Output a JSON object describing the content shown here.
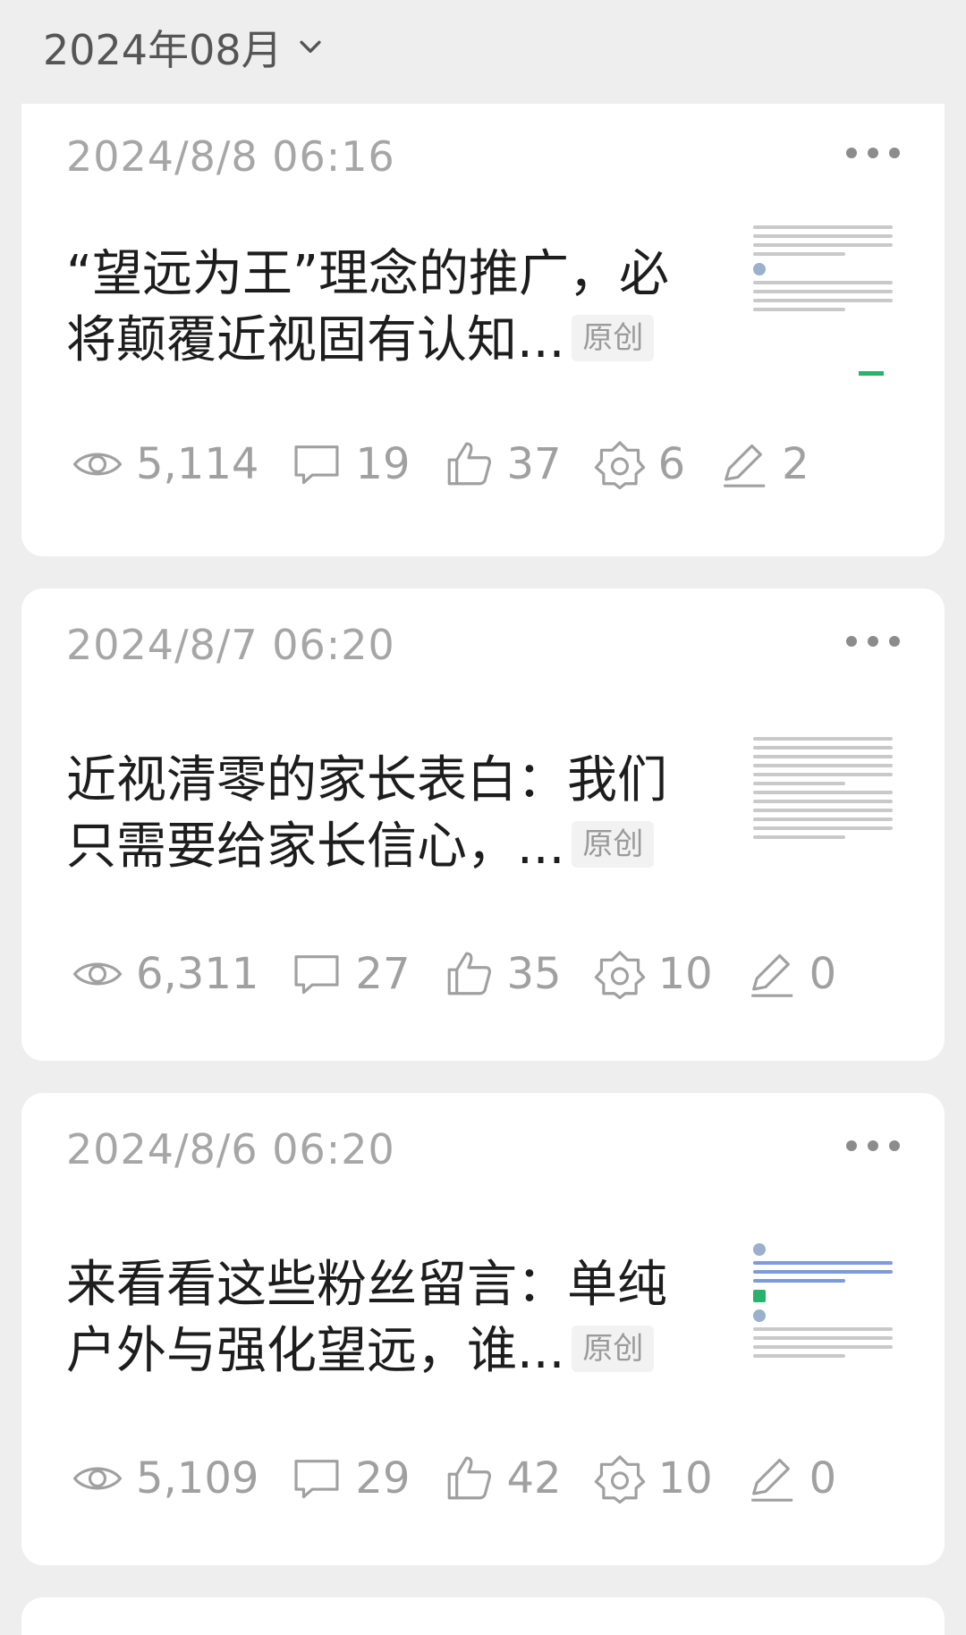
{
  "header": {
    "month_label": "2024年08月",
    "dropdown_icon": "chevron-down-icon"
  },
  "articles": [
    {
      "date": "2024/8/8 06:16",
      "title": "“望远为王”理念的推广，必将颠覆近视固有认知...",
      "tag": "原创",
      "stats": {
        "views": "5,114",
        "comments": "19",
        "likes": "37",
        "shares": "6",
        "edits": "2"
      }
    },
    {
      "date": "2024/8/7 06:20",
      "title": "近视清零的家长表白：我们只需要给家长信心，...",
      "tag": "原创",
      "stats": {
        "views": "6,311",
        "comments": "27",
        "likes": "35",
        "shares": "10",
        "edits": "0"
      }
    },
    {
      "date": "2024/8/6 06:20",
      "title": "来看看这些粉丝留言：单纯户外与强化望远，谁...",
      "tag": "原创",
      "stats": {
        "views": "5,109",
        "comments": "29",
        "likes": "42",
        "shares": "10",
        "edits": "0"
      }
    }
  ],
  "icons": [
    "eye-icon",
    "comment-icon",
    "thumbs-up-icon",
    "share-icon",
    "pen-icon",
    "more-icon"
  ],
  "colors": {
    "background": "#eeeeee",
    "card": "#ffffff",
    "muted_text": "#a0a0a0",
    "title_text": "#1d1d1d"
  }
}
